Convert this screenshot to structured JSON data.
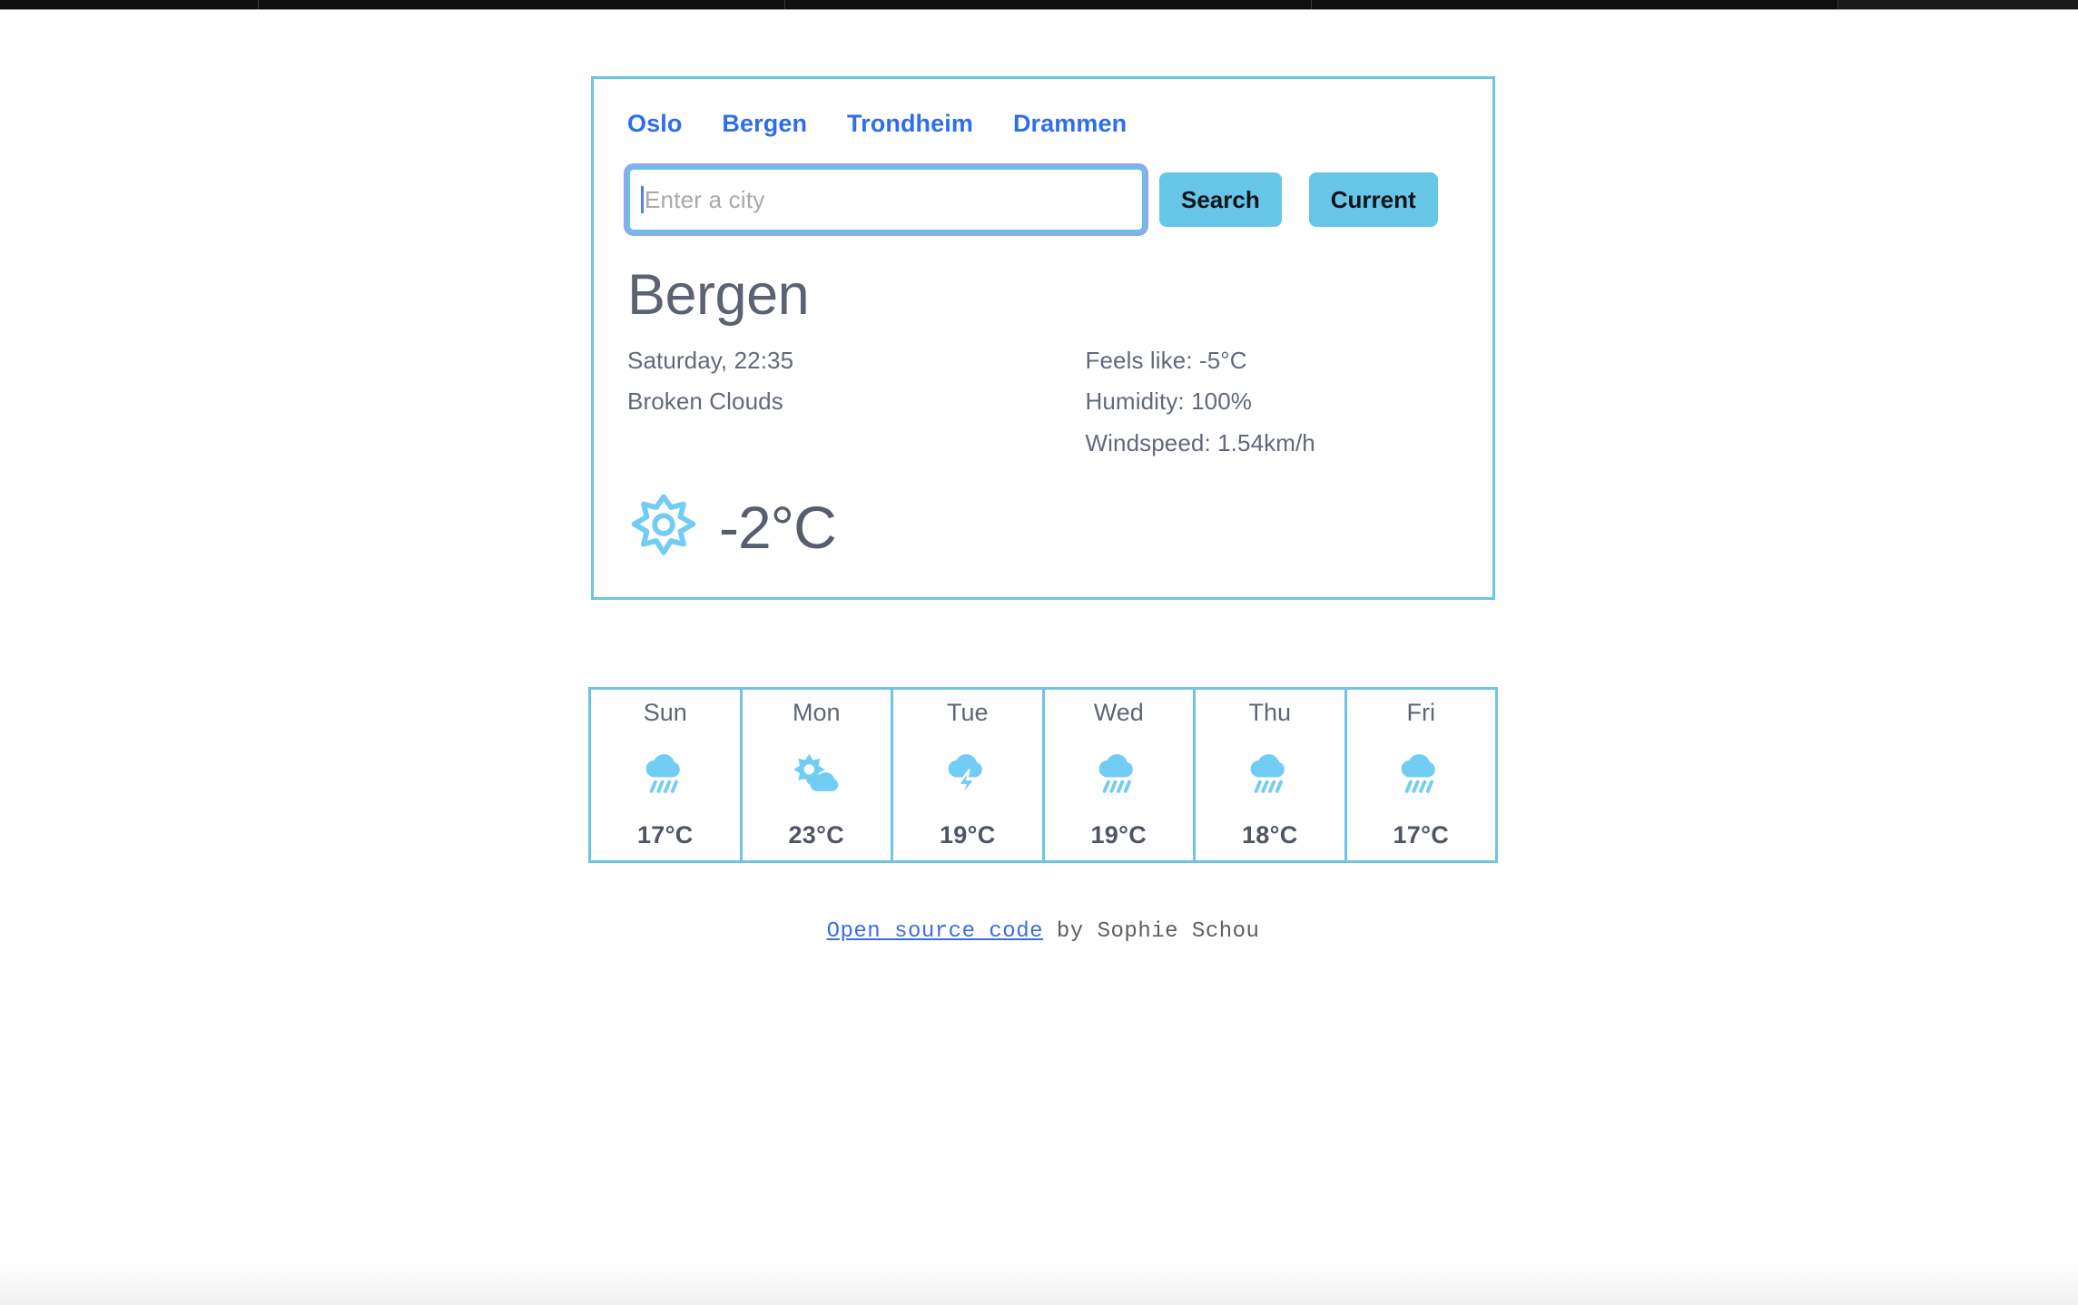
{
  "nav": {
    "items": [
      {
        "label": "Oslo"
      },
      {
        "label": "Bergen"
      },
      {
        "label": "Trondheim"
      },
      {
        "label": "Drammen"
      }
    ]
  },
  "search": {
    "placeholder": "Enter a city",
    "value": "",
    "search_label": "Search",
    "current_label": "Current"
  },
  "current": {
    "city": "Bergen",
    "datetime": "Saturday, 22:35",
    "description": "Broken Clouds",
    "feels_like": "Feels like: -5°C",
    "humidity": "Humidity: 100%",
    "windspeed": "Windspeed: 1.54km/h",
    "temperature": "-2°C",
    "icon": "sun-icon"
  },
  "forecast": {
    "days": [
      {
        "label": "Sun",
        "temp": "17°C",
        "icon": "rain-cloud-icon"
      },
      {
        "label": "Mon",
        "temp": "23°C",
        "icon": "sun-behind-cloud-icon"
      },
      {
        "label": "Tue",
        "temp": "19°C",
        "icon": "thunderstorm-icon"
      },
      {
        "label": "Wed",
        "temp": "19°C",
        "icon": "rain-cloud-icon"
      },
      {
        "label": "Thu",
        "temp": "18°C",
        "icon": "rain-cloud-icon"
      },
      {
        "label": "Fri",
        "temp": "17°C",
        "icon": "rain-cloud-icon"
      }
    ]
  },
  "footer": {
    "link_label": "Open source code",
    "credit": " by Sophie Schou"
  },
  "colors": {
    "accent": "#6ec4e3",
    "link": "#2d6df0",
    "text": "#5b6373",
    "icon": "#6ec8f0"
  }
}
